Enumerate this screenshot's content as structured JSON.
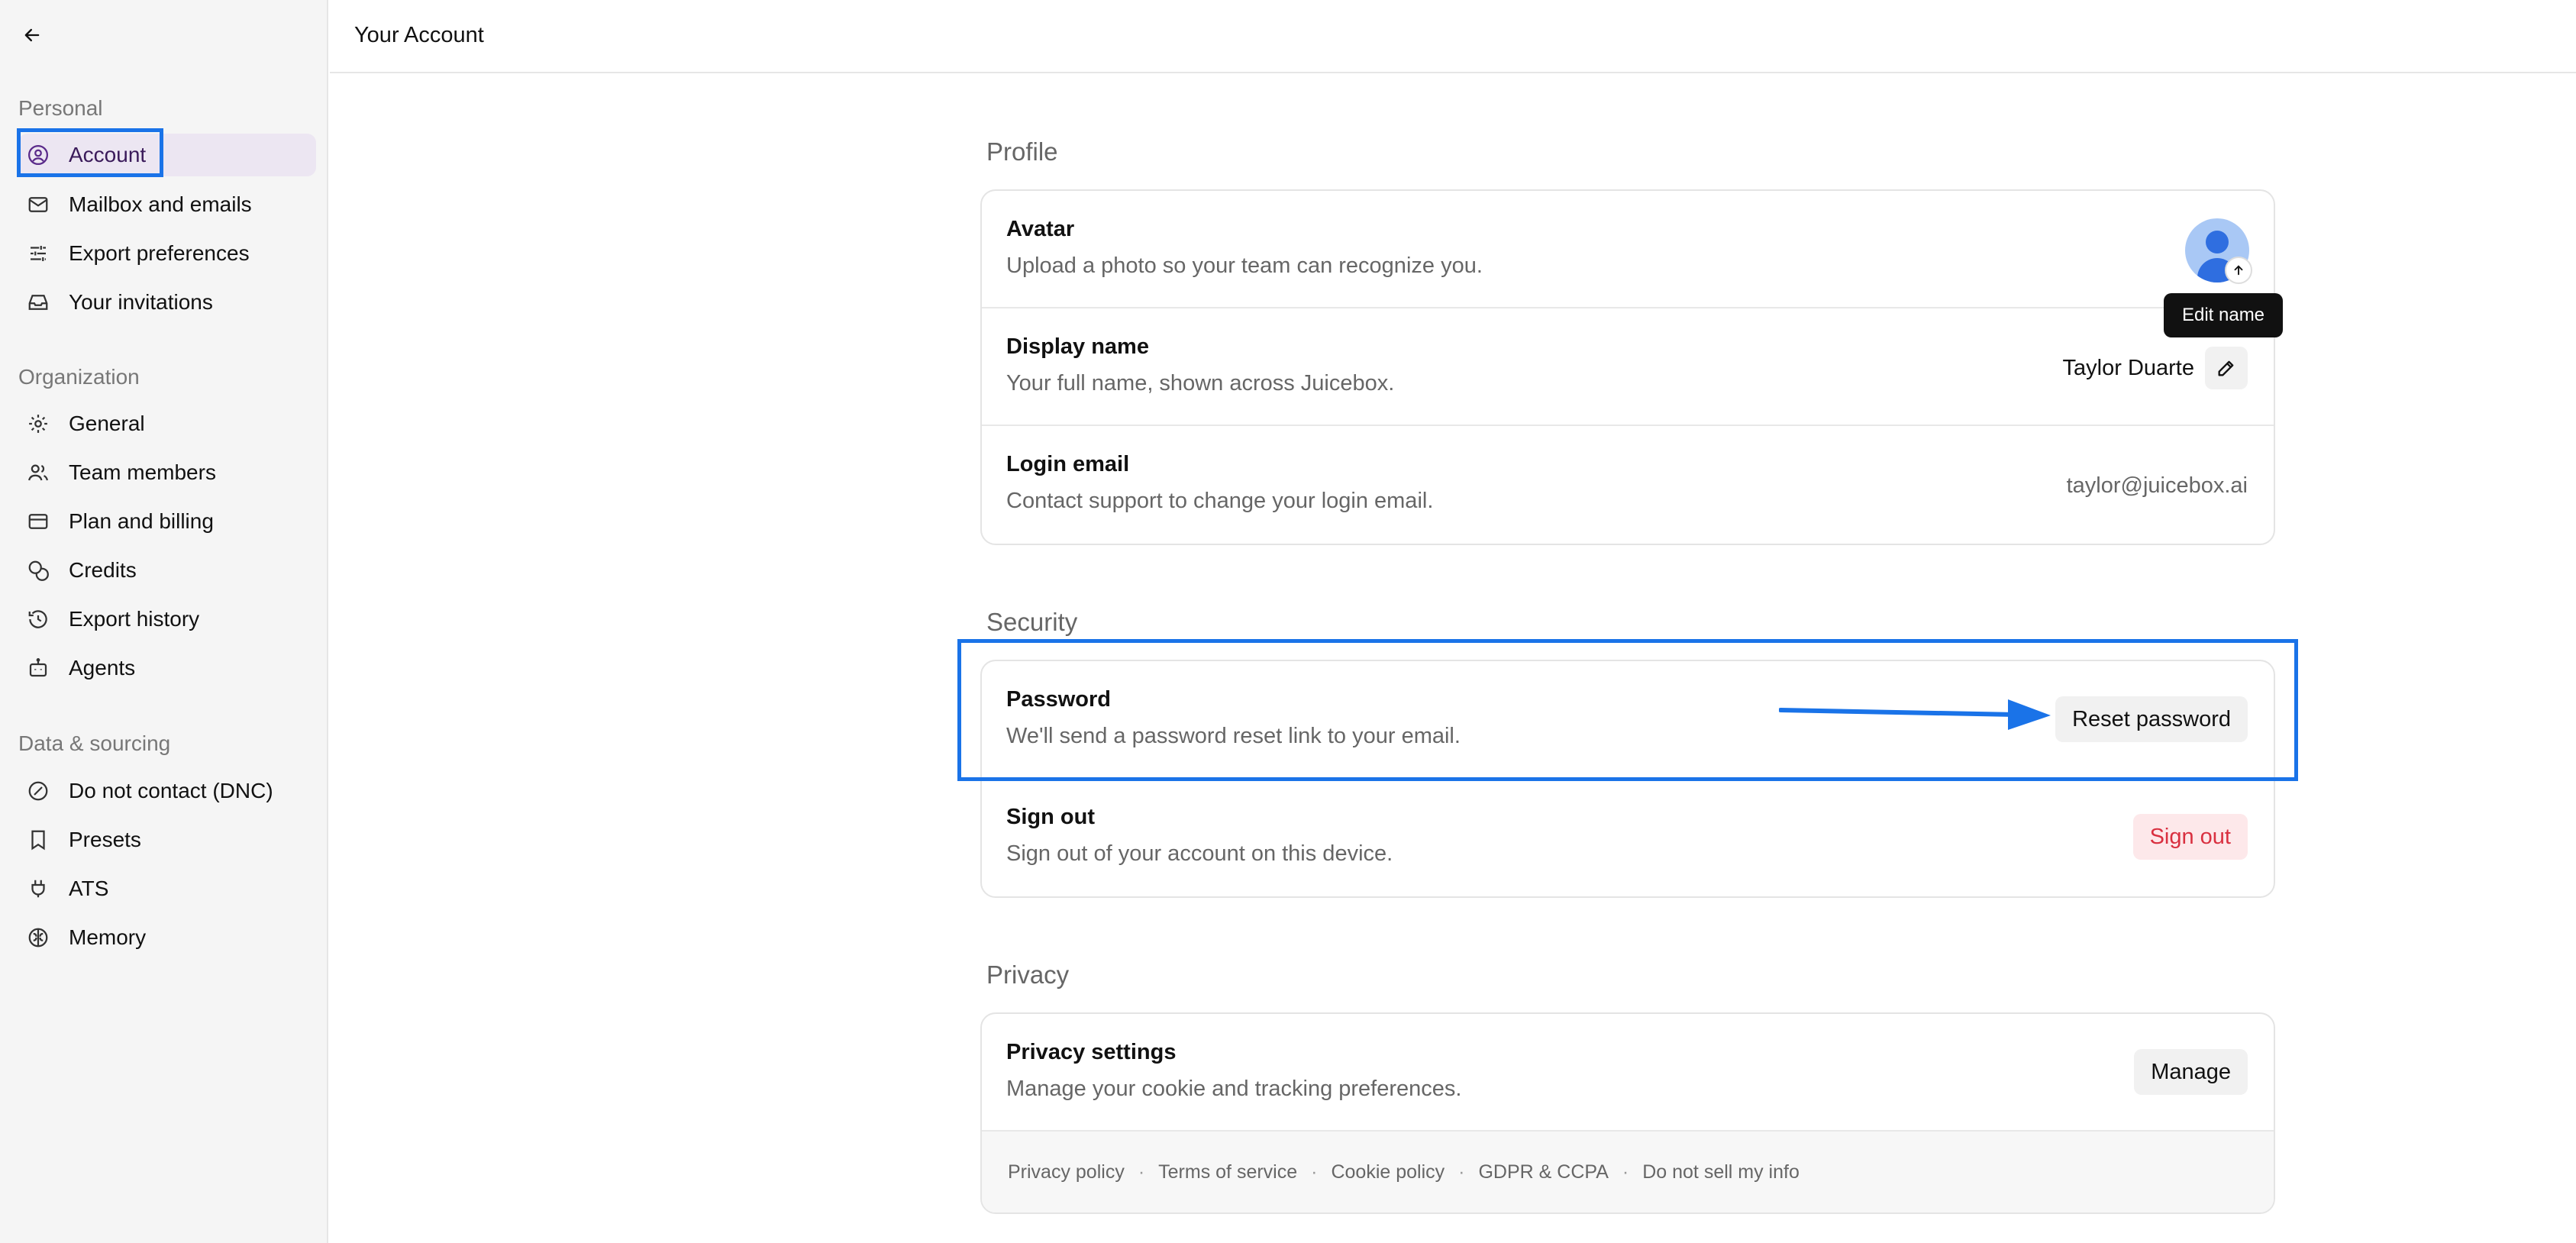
{
  "window": {
    "title": "Your Account"
  },
  "sidebar": {
    "sections": [
      {
        "label": "Personal"
      },
      {
        "label": "Organization"
      },
      {
        "label": "Data & sourcing"
      }
    ],
    "items": [
      {
        "label": "Account",
        "icon": "user-circle-icon",
        "active": true
      },
      {
        "label": "Mailbox and emails",
        "icon": "mail-icon"
      },
      {
        "label": "Export preferences",
        "icon": "sliders-icon"
      },
      {
        "label": "Your invitations",
        "icon": "inbox-icon"
      },
      {
        "label": "General",
        "icon": "gear-icon"
      },
      {
        "label": "Team members",
        "icon": "users-icon"
      },
      {
        "label": "Plan and billing",
        "icon": "credit-card-icon"
      },
      {
        "label": "Credits",
        "icon": "coins-icon"
      },
      {
        "label": "Export history",
        "icon": "history-icon"
      },
      {
        "label": "Agents",
        "icon": "bot-icon"
      },
      {
        "label": "Do not contact (DNC)",
        "icon": "ban-icon"
      },
      {
        "label": "Presets",
        "icon": "bookmark-icon"
      },
      {
        "label": "ATS",
        "icon": "plug-icon"
      },
      {
        "label": "Memory",
        "icon": "brain-icon"
      }
    ]
  },
  "profile": {
    "title": "Profile",
    "avatar": {
      "title": "Avatar",
      "desc": "Upload a photo so your team can recognize you."
    },
    "display_name": {
      "title": "Display name",
      "desc": "Your full name, shown across Juicebox.",
      "value": "Taylor Duarte"
    },
    "login_email": {
      "title": "Login email",
      "desc": "Contact support to change your login email.",
      "value": "taylor@juicebox.ai"
    },
    "tooltip": "Edit name"
  },
  "security": {
    "title": "Security",
    "password": {
      "title": "Password",
      "desc": "We'll send a password reset link to your email.",
      "button": "Reset password"
    },
    "sign_out": {
      "title": "Sign out",
      "desc": "Sign out of your account on this device.",
      "button": "Sign out"
    }
  },
  "privacy": {
    "title": "Privacy",
    "settings": {
      "title": "Privacy settings",
      "desc": "Manage your cookie and tracking preferences.",
      "button": "Manage"
    },
    "links": [
      "Privacy policy",
      "Terms of service",
      "Cookie policy",
      "GDPR & CCPA",
      "Do not sell my info"
    ],
    "separator": "·"
  },
  "colors": {
    "accent": "#1a73e8",
    "active_bg": "#ece6f2",
    "danger": "#d93040",
    "avatar_bg": "#a9c8f5"
  }
}
